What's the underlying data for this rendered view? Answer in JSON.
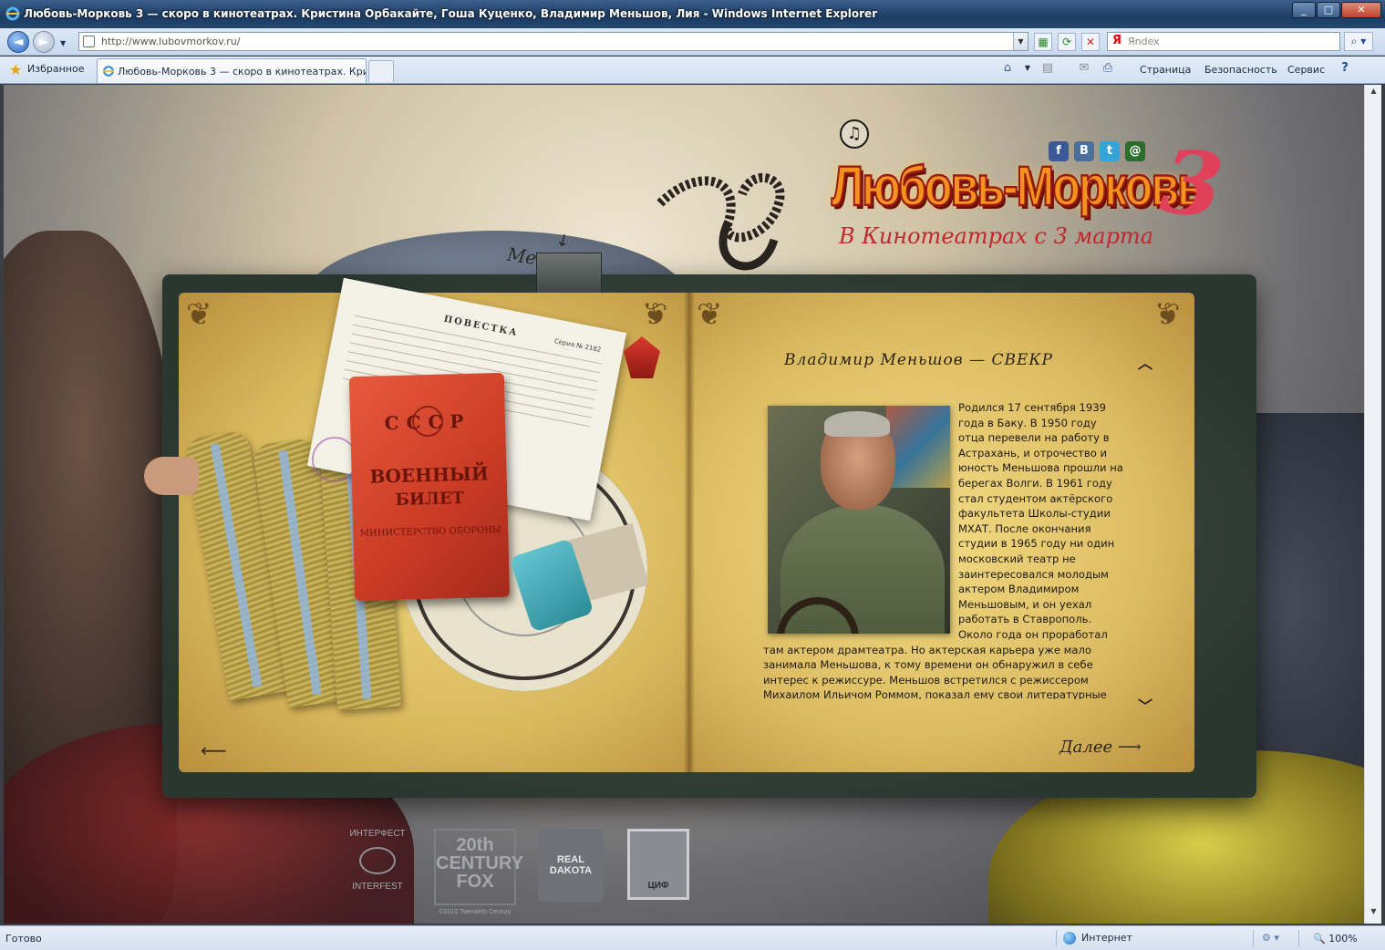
{
  "window": {
    "title": "Любовь-Морковь 3 — скоро в кинотеатрах. Кристина Орбакайте, Гоша Куценко, Владимир Меньшов, Лия - Windows Internet Explorer",
    "minimize": "_",
    "maximize": "□",
    "close": "✕"
  },
  "navbar": {
    "back": "◄",
    "forward": "►",
    "url": "http://www.lubovmorkov.ru/",
    "search_placeholder": "Яndex",
    "search_logo": "Я"
  },
  "favbar": {
    "favorites_label": "Избранное",
    "tab_title": "Любовь-Морковь 3 — скоро в кинотеатрах. Крист...",
    "commands": [
      "Страница",
      "Безопасность",
      "Сервис"
    ]
  },
  "page": {
    "menu_label": "Меню",
    "music_icon": "♫",
    "social": [
      {
        "name": "facebook",
        "glyph": "f",
        "color": "#3b5998"
      },
      {
        "name": "vkontakte",
        "glyph": "B",
        "color": "#4a6f98"
      },
      {
        "name": "twitter",
        "glyph": "t",
        "color": "#35a5d9"
      },
      {
        "name": "mail",
        "glyph": "@",
        "color": "#2b6d2b"
      }
    ],
    "logo_text": "Любовь-Морковь",
    "logo_number": "3",
    "tagline": "В Кинотеатрах с 3 марта",
    "left_page": {
      "povestka_title": "ПОВЕСТКА",
      "povestka_serial": "Серия № 2182",
      "card_country": "СССР",
      "card_title_1": "ВОЕННЫЙ",
      "card_title_2": "БИЛЕТ",
      "card_ministry": "МИНИСТЕРСТВО ОБОРОНЫ",
      "prev_arrow": "⟵"
    },
    "right_page": {
      "actor_title": "Владимир Меньшов — СВЕКР",
      "scroll_up": "︿",
      "scroll_down": "﹀",
      "bio": "Родился 17 сентября 1939 года в Баку. В 1950 году отца перевели на работу в Астрахань, и отрочество и юность Меньшова прошли на берегах Волги. В 1961 году стал студентом актёрского факультета Школы-студии МХАТ. После окончания студии в 1965 году ни один московский театр не заинтересовался молодым актером Владимиром Меньшовым, и он уехал работать в Ставрополь. Около года он проработал там актером драмтеатра. Но актерская карьера уже мало занимала Меньшова, к тому времени он обнаружил в себе интерес к режиссуре. Меньшов встретился с режиссером Михаилом Ильичом Роммом, показал ему свои литературные опыты, и Ромм",
      "next_label": "Далее ⟶"
    },
    "partners": {
      "interfest_top": "ИНТЕРФЕСТ",
      "interfest_bottom": "INTERFEST",
      "fox": "20th CENTURY FOX",
      "fox_copy": "©2010 Twentieth Century Fox",
      "real_dakota": "REAL DAKOTA",
      "cif": "ЦИФ"
    }
  },
  "statusbar": {
    "status": "Готово",
    "zone": "Интернет",
    "zoom": "🔍 100%"
  }
}
